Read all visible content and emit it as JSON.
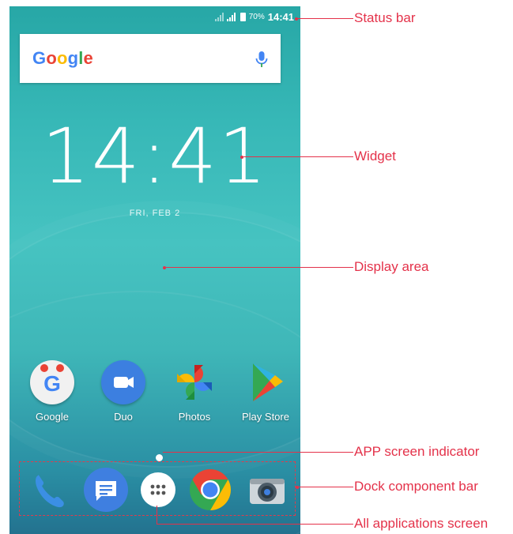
{
  "status_bar": {
    "battery": "70%",
    "time": "14:41"
  },
  "search_widget": {
    "logo": "Google"
  },
  "clock_widget": {
    "time": "14:41",
    "date": "FRI, FEB 2"
  },
  "apps": [
    {
      "label": "Google",
      "icon": "google-icon"
    },
    {
      "label": "Duo",
      "icon": "duo-icon"
    },
    {
      "label": "Photos",
      "icon": "photos-icon"
    },
    {
      "label": "Play Store",
      "icon": "play-store-icon"
    }
  ],
  "dock": [
    {
      "icon": "phone-icon"
    },
    {
      "icon": "messages-icon"
    },
    {
      "icon": "all-apps-icon"
    },
    {
      "icon": "chrome-icon"
    },
    {
      "icon": "camera-icon"
    }
  ],
  "callouts": {
    "status_bar": "Status bar",
    "widget": "Widget",
    "display_area": "Display area",
    "app_screen_indicator": "APP screen indicator",
    "dock_component_bar": "Dock component bar",
    "all_applications_screen": "All applications screen"
  },
  "colors": {
    "callout": "#e4324a",
    "wallpaper_top": "#27a7a6",
    "wallpaper_bottom": "#23728f"
  }
}
